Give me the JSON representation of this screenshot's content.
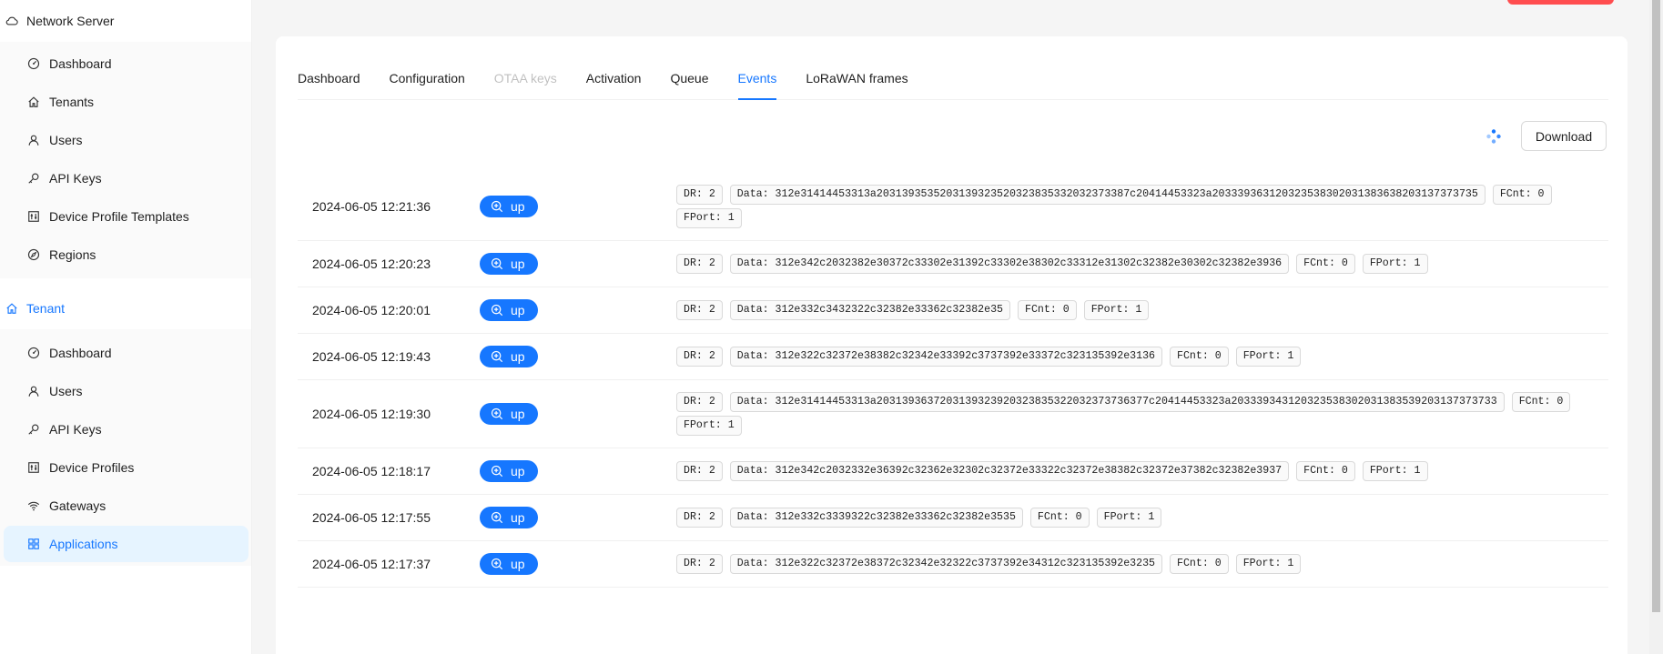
{
  "sidebar": {
    "network_server": {
      "label": "Network Server",
      "icon": "cloud-icon",
      "items": [
        {
          "label": "Dashboard",
          "icon": "dashboard-icon"
        },
        {
          "label": "Tenants",
          "icon": "home-icon"
        },
        {
          "label": "Users",
          "icon": "user-icon"
        },
        {
          "label": "API Keys",
          "icon": "key-icon"
        },
        {
          "label": "Device Profile Templates",
          "icon": "control-icon"
        },
        {
          "label": "Regions",
          "icon": "compass-icon"
        }
      ]
    },
    "tenant": {
      "label": "Tenant",
      "icon": "home-icon",
      "items": [
        {
          "label": "Dashboard",
          "icon": "dashboard-icon"
        },
        {
          "label": "Users",
          "icon": "user-icon"
        },
        {
          "label": "API Keys",
          "icon": "key-icon"
        },
        {
          "label": "Device Profiles",
          "icon": "control-icon"
        },
        {
          "label": "Gateways",
          "icon": "wifi-icon"
        },
        {
          "label": "Applications",
          "icon": "appstore-icon"
        }
      ]
    }
  },
  "tabs": [
    "Dashboard",
    "Configuration",
    "OTAA keys",
    "Activation",
    "Queue",
    "Events",
    "LoRaWAN frames"
  ],
  "active_tab": "Events",
  "download_label": "Download",
  "colors": {
    "accent": "#1677ff",
    "danger": "#ff4d4f"
  },
  "events": [
    {
      "time": "2024-06-05 12:21:36",
      "type": "up",
      "tags": [
        "DR: 2",
        "Data: 312e31414453313a2031393535203139323520323835332032373387c20414453323a203339363120323538302031383638203137373735",
        "FCnt: 0",
        "FPort: 1"
      ]
    },
    {
      "time": "2024-06-05 12:20:23",
      "type": "up",
      "tags": [
        "DR: 2",
        "Data: 312e342c2032382e30372c33302e31392c33302e38302c33312e31302c32382e30302c32382e3936",
        "FCnt: 0",
        "FPort: 1"
      ]
    },
    {
      "time": "2024-06-05 12:20:01",
      "type": "up",
      "tags": [
        "DR: 2",
        "Data: 312e332c3432322c32382e33362c32382e35",
        "FCnt: 0",
        "FPort: 1"
      ]
    },
    {
      "time": "2024-06-05 12:19:43",
      "type": "up",
      "tags": [
        "DR: 2",
        "Data: 312e322c32372e38382c32342e33392c3737392e33372c323135392e3136",
        "FCnt: 0",
        "FPort: 1"
      ]
    },
    {
      "time": "2024-06-05 12:19:30",
      "type": "up",
      "tags": [
        "DR: 2",
        "Data: 312e31414453313a2031393637203139323920323835322032373736377c20414453323a203339343120323538302031383539203137373733",
        "FCnt: 0",
        "FPort: 1"
      ]
    },
    {
      "time": "2024-06-05 12:18:17",
      "type": "up",
      "tags": [
        "DR: 2",
        "Data: 312e342c2032332e36392c32362e32302c32372e33322c32372e38382c32372e37382c32382e3937",
        "FCnt: 0",
        "FPort: 1"
      ]
    },
    {
      "time": "2024-06-05 12:17:55",
      "type": "up",
      "tags": [
        "DR: 2",
        "Data: 312e332c3339322c32382e33362c32382e3535",
        "FCnt: 0",
        "FPort: 1"
      ]
    },
    {
      "time": "2024-06-05 12:17:37",
      "type": "up",
      "tags": [
        "DR: 2",
        "Data: 312e322c32372e38372c32342e32322c3737392e34312c323135392e3235",
        "FCnt: 0",
        "FPort: 1"
      ]
    }
  ]
}
